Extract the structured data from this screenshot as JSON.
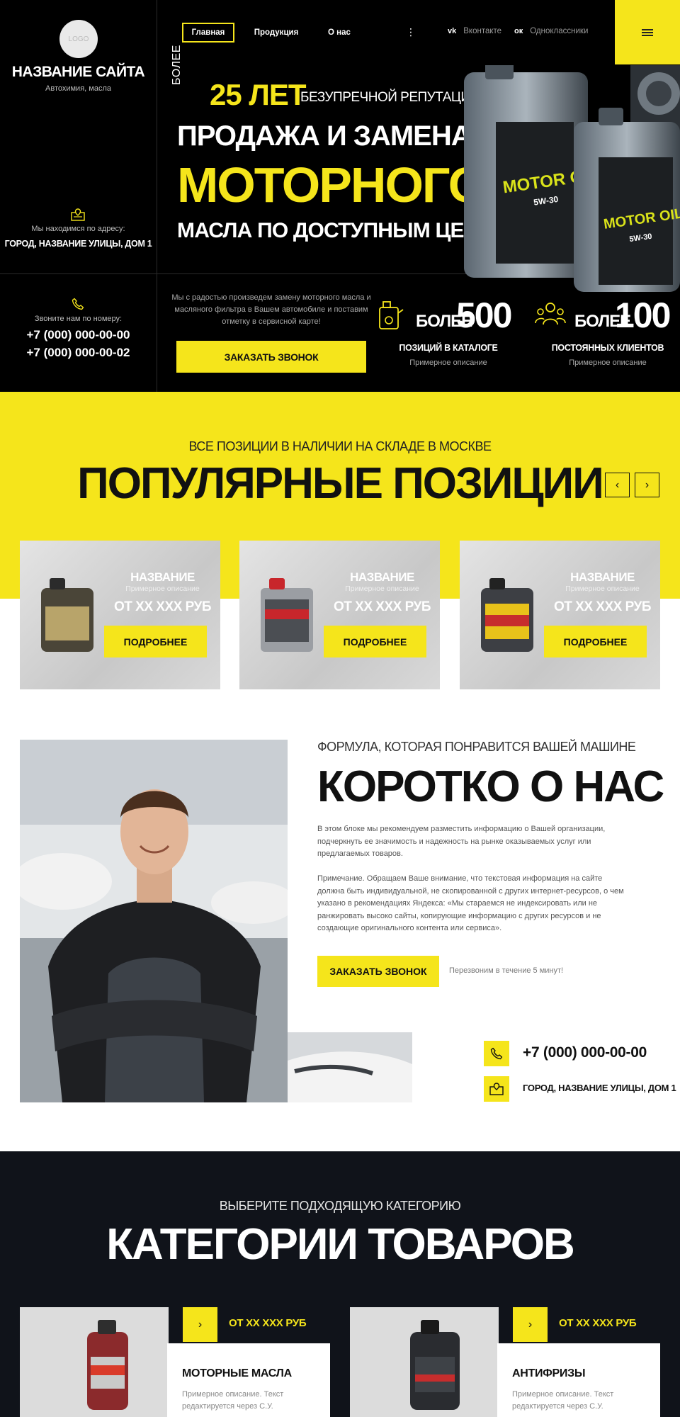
{
  "header": {
    "logo_text": "LOGO",
    "site_name": "НАЗВАНИЕ САЙТА",
    "site_sub": "Автохимия, масла",
    "address_label": "Мы находимся по адресу:",
    "address_value": "ГОРОД, НАЗВАНИЕ УЛИЦЫ, ДОМ 1",
    "phone_label": "Звоните нам по номеру:",
    "phone_1": "+7 (000) 000-00-00",
    "phone_2": "+7 (000) 000-00-02"
  },
  "nav": {
    "items": [
      "Главная",
      "Продукция",
      "О нас"
    ],
    "more": "⋮",
    "social": [
      {
        "icon": "vk-icon",
        "glyph": "vk",
        "label": "Вконтакте"
      },
      {
        "icon": "ok-icon",
        "glyph": "ок",
        "label": "Одноклассники"
      }
    ]
  },
  "hero": {
    "bolee": "БОЛЕЕ",
    "years": "25 ЛЕТ",
    "reputation": "БЕЗУПРЕЧНОЙ РЕПУТАЦИИ",
    "line1": "ПРОДАЖА И ЗАМЕНА",
    "line2": "МОТОРНОГО",
    "line3": "МАСЛА ПО ДОСТУПНЫМ ЦЕНАМ",
    "promo": "Мы с радостью произведем замену моторного масла и масляного фильтра в Вашем автомобиле и поставим отметку в сервисной карте!",
    "order_button": "ЗАКАЗАТЬ ЗВОНОК",
    "bottle_label_1": "MOTOR OIL",
    "bottle_label_2": "MOTOR OIL",
    "bottle_spec": "5W-30",
    "stats": [
      {
        "bolee": "БОЛЕЕ",
        "number": "500",
        "label": "ПОЗИЦИЙ В КАТАЛОГЕ",
        "desc": "Примерное описание",
        "icon": "oil-can-icon"
      },
      {
        "bolee": "БОЛЕЕ",
        "number": "100",
        "label": "ПОСТОЯННЫХ КЛИЕНТОВ",
        "desc": "Примерное описание",
        "icon": "clients-icon"
      }
    ]
  },
  "popular": {
    "subtitle": "ВСЕ ПОЗИЦИИ В НАЛИЧИИ НА СКЛАДЕ В МОСКВЕ",
    "title": "ПОПУЛЯРНЫЕ ПОЗИЦИИ",
    "prev": "‹",
    "next": "›",
    "cards": [
      {
        "name": "НАЗВАНИЕ",
        "desc": "Примерное описание",
        "price": "ОТ XX XXX РУБ",
        "button": "ПОДРОБНЕЕ",
        "color": "#4a4538",
        "label_color": "#b8a46a"
      },
      {
        "name": "НАЗВАНИЕ",
        "desc": "Примерное описание",
        "price": "ОТ XX XXX РУБ",
        "button": "ПОДРОБНЕЕ",
        "color": "#9b9ea3",
        "label_color": "#c8262b"
      },
      {
        "name": "НАЗВАНИЕ",
        "desc": "Примерное описание",
        "price": "ОТ XX XXX РУБ",
        "button": "ПОДРОБНЕЕ",
        "color": "#3d3f44",
        "label_color": "#e8c21a"
      }
    ]
  },
  "about": {
    "subtitle": "ФОРМУЛА, КОТОРАЯ ПОНРАВИТСЯ ВАШЕЙ МАШИНЕ",
    "title": "КОРОТКО О НАС",
    "p1": "В этом блоке мы рекомендуем разместить информацию о Вашей организации, подчеркнуть ее значимость и надежность на рынке оказываемых услуг или предлагаемых товаров.",
    "p2": "Примечание. Обращаем Ваше внимание, что текстовая информация на сайте должна быть индивидуальной, не скопированной с других интернет-ресурсов, о чем указано в рекомендациях Яндекса: «Мы стараемся не индексировать или не ранжировать высоко сайты, копирующие информацию с других ресурсов и не создающие оригинального контента или сервиса».",
    "button": "ЗАКАЗАТЬ ЗВОНОК",
    "callback": "Перезвоним в течение 5 минут!",
    "phone": "+7 (000) 000-00-00",
    "address": "ГОРОД, НАЗВАНИЕ УЛИЦЫ, ДОМ 1"
  },
  "categories": {
    "subtitle": "ВЫБЕРИТЕ ПОДХОДЯЩУЮ КАТЕГОРИЮ",
    "title": "КАТЕГОРИИ ТОВАРОВ",
    "items": [
      {
        "name": "МОТОРНЫЕ МАСЛА",
        "price": "ОТ XX XXX РУБ",
        "desc": "Примерное описание. Текст редактируется через С.У.",
        "go": "›"
      },
      {
        "name": "АНТИФРИЗЫ",
        "price": "ОТ XX XXX РУБ",
        "desc": "Примерное описание. Текст редактируется через С.У.",
        "go": "›"
      }
    ]
  },
  "colors": {
    "accent": "#f5e51b",
    "dark": "#000000",
    "navy": "#10131a"
  }
}
